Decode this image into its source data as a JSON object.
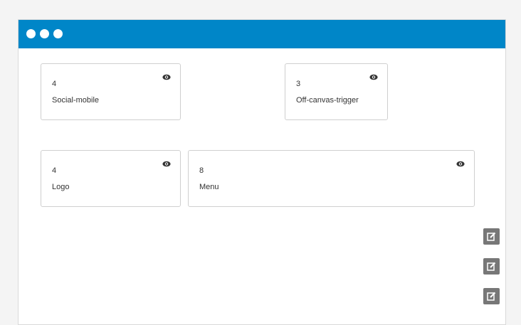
{
  "window": {
    "titlebar_color": "#0086c8",
    "dots": [
      "window-dot",
      "window-dot",
      "window-dot"
    ]
  },
  "rows": [
    {
      "modules": [
        {
          "size": "4",
          "name": "Social-mobile",
          "icon": "eye-icon"
        },
        {
          "size": "3",
          "name": "Off-canvas-trigger",
          "icon": "eye-icon"
        }
      ]
    },
    {
      "modules": [
        {
          "size": "4",
          "name": "Logo",
          "icon": "eye-icon"
        },
        {
          "size": "8",
          "name": "Menu",
          "icon": "eye-icon"
        }
      ]
    }
  ],
  "side_buttons": [
    {
      "icon": "edit-icon"
    },
    {
      "icon": "edit-icon"
    },
    {
      "icon": "edit-icon"
    }
  ]
}
